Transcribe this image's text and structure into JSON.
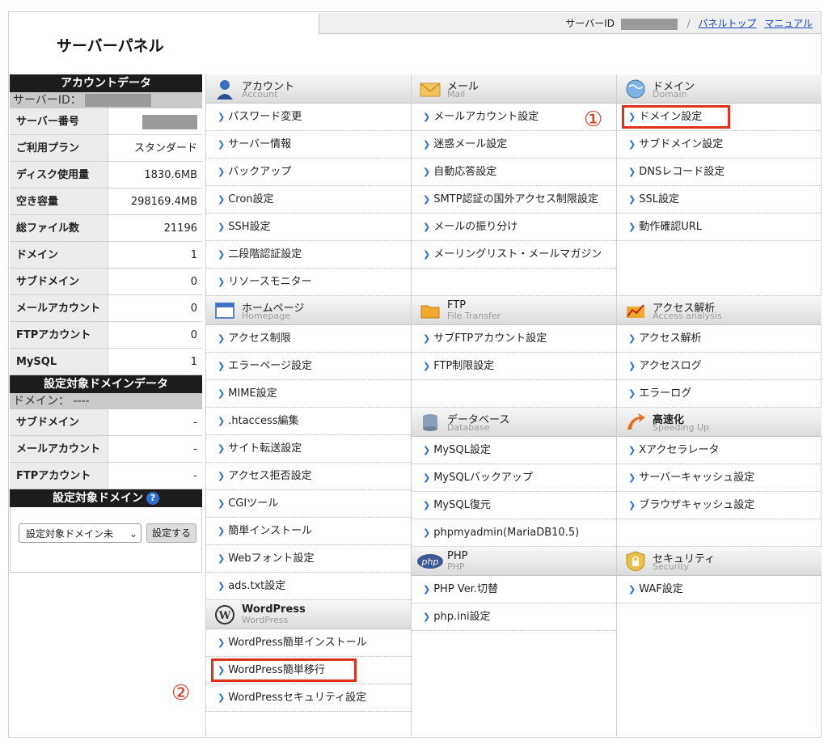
{
  "header": {
    "title": "サーバーパネル",
    "server_id_label": "サーバーID",
    "link_panel_top": "パネルトップ",
    "link_manual": "マニュアル",
    "separator": "/"
  },
  "account_data": {
    "heading": "アカウントデータ",
    "server_id_label": "サーバーID：",
    "rows": [
      {
        "label": "サーバー番号",
        "value": ""
      },
      {
        "label": "ご利用プラン",
        "value": "スタンダード"
      },
      {
        "label": "ディスク使用量",
        "value": "1830.6MB"
      },
      {
        "label": "空き容量",
        "value": "298169.4MB"
      },
      {
        "label": "総ファイル数",
        "value": "21196"
      },
      {
        "label": "ドメイン",
        "value": "1"
      },
      {
        "label": "サブドメイン",
        "value": "0"
      },
      {
        "label": "メールアカウント",
        "value": "0"
      },
      {
        "label": "FTPアカウント",
        "value": "0"
      },
      {
        "label": "MySQL",
        "value": "1"
      }
    ]
  },
  "target_domain_data": {
    "heading": "設定対象ドメインデータ",
    "domain_label": "ドメイン： ----",
    "rows": [
      {
        "label": "サブドメイン",
        "value": "-"
      },
      {
        "label": "メールアカウント",
        "value": "-"
      },
      {
        "label": "FTPアカウント",
        "value": "-"
      }
    ]
  },
  "target_domain": {
    "heading": "設定対象ドメイン",
    "help": "?",
    "select_value": "設定対象ドメイン未",
    "chevron": "⌄",
    "button": "設定する"
  },
  "arrow": "❯",
  "sections": {
    "account": {
      "title": "アカウント",
      "sub": "Account",
      "items": [
        "パスワード変更",
        "サーバー情報",
        "バックアップ",
        "Cron設定",
        "SSH設定",
        "二段階認証設定",
        "リソースモニター"
      ]
    },
    "homepage": {
      "title": "ホームページ",
      "sub": "Homepage",
      "items": [
        "アクセス制限",
        "エラーページ設定",
        "MIME設定",
        ".htaccess編集",
        "サイト転送設定",
        "アクセス拒否設定",
        "CGIツール",
        "簡単インストール",
        "Webフォント設定",
        "ads.txt設定"
      ]
    },
    "wordpress": {
      "title": "WordPress",
      "sub": "WordPress",
      "items": [
        "WordPress簡単インストール",
        "WordPress簡単移行",
        "WordPressセキュリティ設定"
      ]
    },
    "mail": {
      "title": "メール",
      "sub": "Mail",
      "items": [
        "メールアカウント設定",
        "迷惑メール設定",
        "自動応答設定",
        "SMTP認証の国外アクセス制限設定",
        "メールの振り分け",
        "メーリングリスト・メールマガジン"
      ]
    },
    "ftp": {
      "title": "FTP",
      "sub": "File Transfer",
      "items": [
        "サブFTPアカウント設定",
        "FTP制限設定"
      ]
    },
    "database": {
      "title": "データベース",
      "sub": "Database",
      "items": [
        "MySQL設定",
        "MySQLバックアップ",
        "MySQL復元",
        "phpmyadmin(MariaDB10.5)"
      ]
    },
    "php": {
      "title": "PHP",
      "sub": "PHP",
      "items": [
        "PHP Ver.切替",
        "php.ini設定"
      ]
    },
    "domain": {
      "title": "ドメイン",
      "sub": "Domain",
      "items": [
        "ドメイン設定",
        "サブドメイン設定",
        "DNSレコード設定",
        "SSL設定",
        "動作確認URL"
      ]
    },
    "access": {
      "title": "アクセス解析",
      "sub": "Access analysis",
      "items": [
        "アクセス解析",
        "アクセスログ",
        "エラーログ"
      ]
    },
    "speed": {
      "title": "高速化",
      "sub": "Speeding Up",
      "items": [
        "Xアクセラレータ",
        "サーバーキャッシュ設定",
        "ブラウザキャッシュ設定"
      ]
    },
    "security": {
      "title": "セキュリティ",
      "sub": "Security",
      "items": [
        "WAF設定"
      ]
    }
  },
  "annotations": {
    "one": "①",
    "two": "②"
  },
  "colors": {
    "highlight": "#e0321b",
    "link": "#1a44c8",
    "dark_header": "#1c1c1c"
  }
}
